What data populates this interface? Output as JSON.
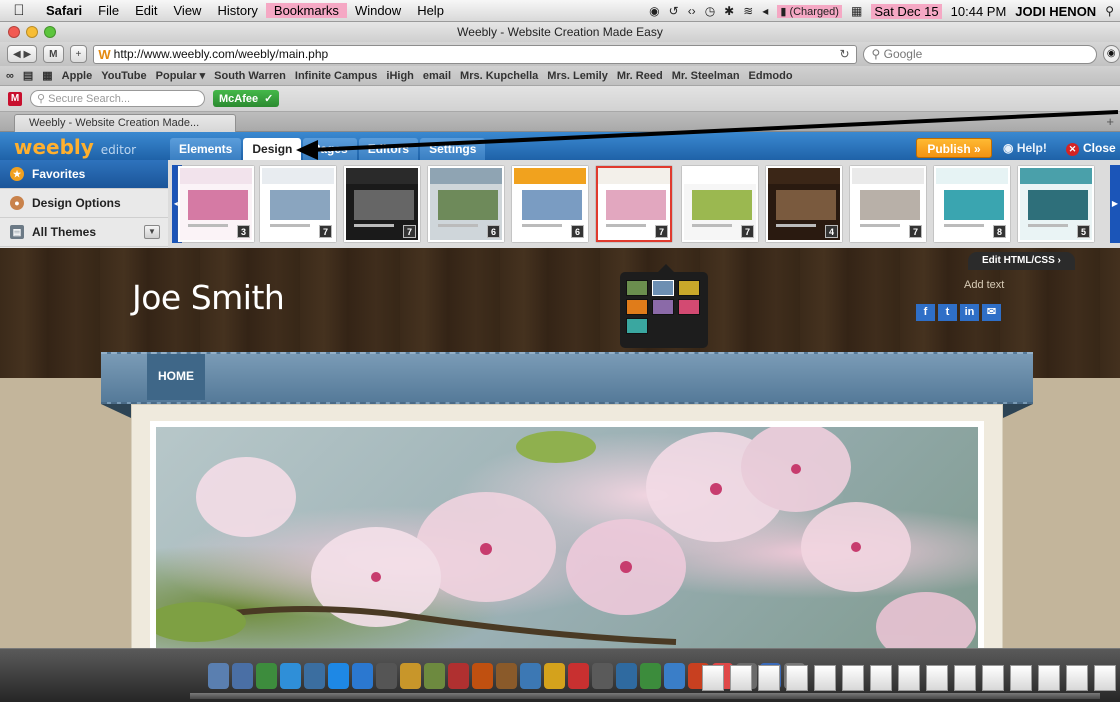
{
  "menubar": {
    "app": "Safari",
    "items": [
      "File",
      "Edit",
      "View",
      "History",
      "Bookmarks",
      "Window",
      "Help"
    ],
    "battery": "(Charged)",
    "date": "Sat Dec 15",
    "time": "10:44 PM",
    "user": "JODI HENON"
  },
  "window": {
    "title": "Weebly - Website Creation Made Easy"
  },
  "toolbar": {
    "url": "http://www.weebly.com/weebly/main.php",
    "search_placeholder": "Google"
  },
  "bookmarks": [
    "Apple",
    "YouTube",
    "Popular ▾",
    "South Warren",
    "Infinite Campus",
    "iHigh",
    "email",
    "Mrs. Kupchella",
    "Mrs. Lemily",
    "Mr. Reed",
    "Mr. Steelman",
    "Edmodo"
  ],
  "mcafee": {
    "search_placeholder": "Secure Search...",
    "label": "McAfee"
  },
  "tab": {
    "title": "Weebly - Website Creation Made..."
  },
  "editor": {
    "logo": "weebly",
    "logo_sub": "editor",
    "tabs": [
      "Elements",
      "Design",
      "Pages",
      "Editors",
      "Settings"
    ],
    "active_tab": "Design",
    "publish": "Publish »",
    "help": "Help!",
    "close": "Close"
  },
  "sidebar": {
    "items": [
      {
        "label": "Favorites"
      },
      {
        "label": "Design Options"
      },
      {
        "label": "All Themes"
      }
    ]
  },
  "themes": {
    "counts": [
      "3",
      "7",
      "7",
      "6",
      "6",
      "7",
      "7",
      "4",
      "7",
      "8",
      "5"
    ],
    "selected_index": 5
  },
  "popup_colors": [
    "#6b8e4e",
    "#6d8fb2",
    "#c9a82a",
    "#e07c1a",
    "#8b6aa8",
    "#d34a72",
    "#3aa7a0"
  ],
  "site": {
    "title": "Joe Smith",
    "edit_html": "Edit HTML/CSS ›",
    "add_text": "Add text",
    "social": [
      "f",
      "t",
      "in",
      "✉"
    ],
    "nav_home": "HOME"
  }
}
